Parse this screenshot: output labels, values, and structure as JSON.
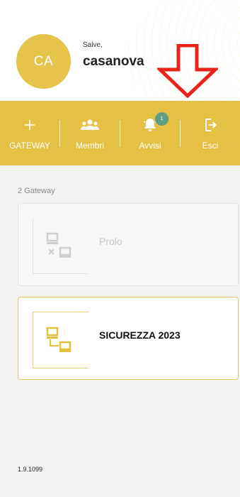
{
  "user": {
    "avatar_initials": "CA",
    "greeting": "Salve,",
    "name": "casanova"
  },
  "colors": {
    "brand": "#e5c044",
    "badge": "#5e9e84",
    "arrow": "#e8231a"
  },
  "toolbar": {
    "items": [
      {
        "label": "GATEWAY",
        "icon": "plus-icon"
      },
      {
        "label": "Membri",
        "icon": "users-icon"
      },
      {
        "label": "Avvisi",
        "icon": "bell-icon",
        "badge": "1"
      },
      {
        "label": "Esci",
        "icon": "logout-icon"
      }
    ]
  },
  "gateways": {
    "count_label": "2 Gateway",
    "items": [
      {
        "name": "Prolo",
        "status": "offline",
        "icon": "network-disconnected-icon"
      },
      {
        "name": "SICUREZZA 2023",
        "status": "online",
        "icon": "network-connected-icon"
      }
    ]
  },
  "footer": {
    "version": "1.9.1099"
  }
}
